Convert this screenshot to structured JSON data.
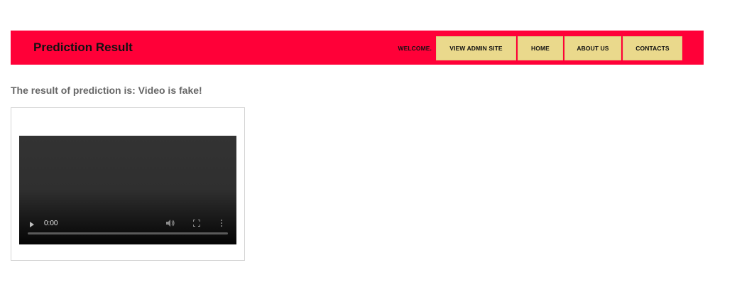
{
  "header": {
    "title": "Prediction Result",
    "welcome": "WELCOME.",
    "nav": {
      "admin": "VIEW ADMIN SITE",
      "home": "HOME",
      "about": "ABOUT US",
      "contacts": "CONTACTS"
    },
    "colors": {
      "bar": "#ff0038",
      "button": "#ead98c"
    }
  },
  "result": {
    "text": "The result of prediction is: Video is fake!"
  },
  "video": {
    "time": "0:00",
    "progress": 0,
    "icons": [
      "play-icon",
      "volume-icon",
      "fullscreen-icon",
      "more-options-icon"
    ]
  }
}
